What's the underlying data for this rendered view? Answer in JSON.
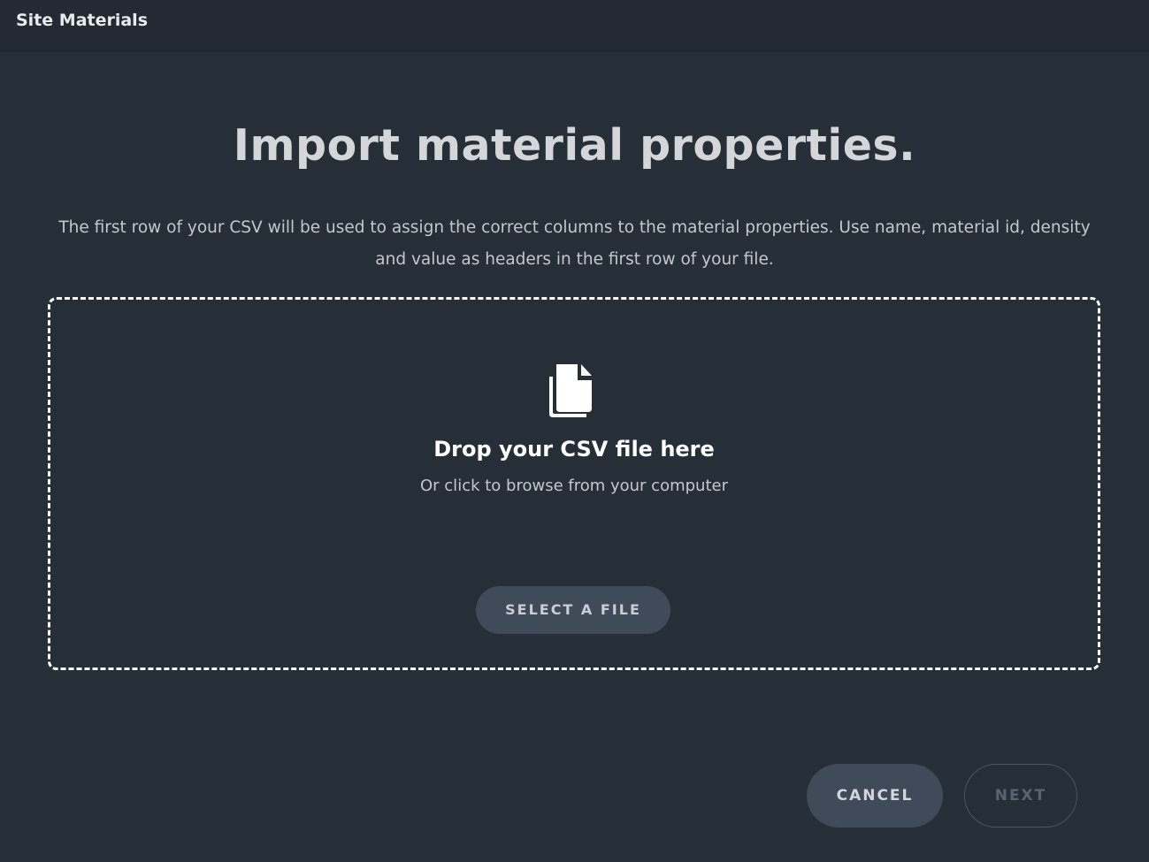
{
  "header": {
    "title": "Site Materials"
  },
  "main": {
    "title": "Import material properties.",
    "description": "The first row of your CSV will be used to assign the correct columns to the material properties. Use name, material id, density and value as headers in the first row of your file."
  },
  "dropzone": {
    "icon": "file-copy-icon",
    "title": "Drop your CSV file here",
    "subtitle": "Or click to browse from your computer",
    "select_label": "SELECT A FILE"
  },
  "footer": {
    "cancel_label": "CANCEL",
    "next_label": "NEXT",
    "next_disabled": true
  },
  "colors": {
    "background": "#262e38",
    "topbar": "#232a33",
    "button": "#3f4b59",
    "dropzone_border": "#ffffff"
  }
}
